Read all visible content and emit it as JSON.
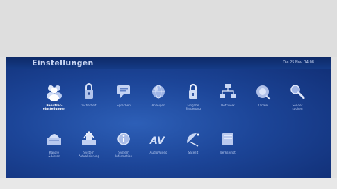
{
  "header": {
    "title": "Einstellungen",
    "datetime": "Die 25 Nov. 14:08"
  },
  "tiles_row1": [
    {
      "label": "Benutzer-\neinstellungen",
      "icon": "people-icon",
      "selected": true
    },
    {
      "label": "Sicherheit",
      "icon": "lock-icon"
    },
    {
      "label": "Sprachen",
      "icon": "speech-icon"
    },
    {
      "label": "Anzeigen",
      "icon": "globe-icon"
    },
    {
      "label": "Eingabe\nSteuerung",
      "icon": "padlock-icon"
    },
    {
      "label": "Netzwerk",
      "icon": "network-icon"
    },
    {
      "label": "Kanäle",
      "icon": "satellite-icon"
    },
    {
      "label": "Sender\nsuchen",
      "icon": "magnifier-icon"
    }
  ],
  "tiles_row2": [
    {
      "label": "Kanäle\n& Listen",
      "icon": "folders-icon"
    },
    {
      "label": "System\nAktualisierung",
      "icon": "update-icon"
    },
    {
      "label": "System\nInformation",
      "icon": "info-icon"
    },
    {
      "label": "Audio/Video",
      "icon": "av-icon"
    },
    {
      "label": "Satellit",
      "icon": "dish-icon"
    },
    {
      "label": "Werkseinst.",
      "icon": "reset-icon"
    }
  ],
  "colors": {
    "panel": "#1c4598",
    "header": "#0e2a67",
    "label": "#b9cbf0",
    "selected_label": "#ffffff"
  }
}
